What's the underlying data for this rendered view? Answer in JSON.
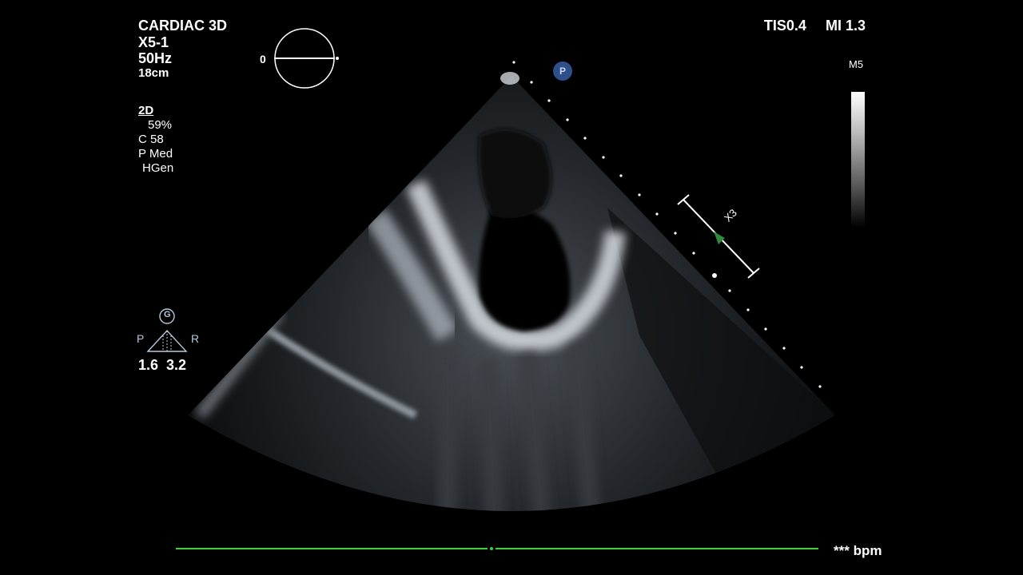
{
  "header": {
    "mode": "CARDIAC 3D",
    "probe": "X5-1",
    "frame_rate": "50Hz",
    "depth": "18cm"
  },
  "params": {
    "mode_label": "2D",
    "gain": "59%",
    "compression": "C 58",
    "power": "P Med",
    "harmonics": "HGen"
  },
  "indices": {
    "tis": "TIS0.4",
    "mi": "MI 1.3"
  },
  "gray_map": "M5",
  "xplane": {
    "angle": "0",
    "label": "X3"
  },
  "orientation": {
    "badge": "G",
    "left": "P",
    "right": "R",
    "values": "1.6  3.2"
  },
  "probe_marker": "P",
  "heart_rate": "*** bpm",
  "colors": {
    "ecg_line": "#3fd23a",
    "marker": "#2e4f8a",
    "arrow": "#2f8a3c",
    "orientation": "#b8c8dc"
  }
}
